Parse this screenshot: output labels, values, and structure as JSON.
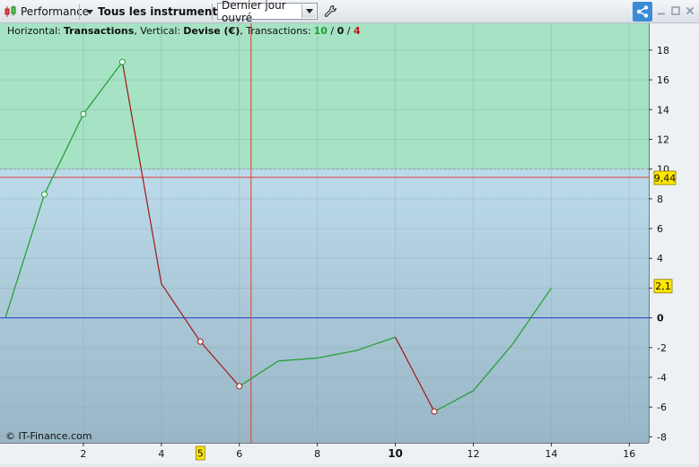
{
  "toolbar": {
    "performance_label": "Performance",
    "instruments_label": "Tous les instruments",
    "period_select": "Dernier jour ouvré"
  },
  "legend": {
    "horizontal_label": "Horizontal:",
    "horizontal_value": "Transactions",
    "vertical_label": ", Vertical:",
    "vertical_value": "Devise (€)",
    "transactions_label": ", Transactions:",
    "win_count": "10",
    "slash1": " / ",
    "neutral_count": "0",
    "slash2": " / ",
    "loss_count": "4"
  },
  "copyright": "© IT-Finance.com",
  "colors": {
    "gain_zone": "#a6e2c4",
    "loss_zone_top": "#bcdbea",
    "loss_zone_bottom": "#98b6c5",
    "up_line": "#1f9e2e",
    "down_line": "#a31616",
    "zero_line": "#1f3fd0",
    "ref_line": "#e03a3a",
    "cursor_line": "#e03a3a",
    "marker_fill": "#ffe600"
  },
  "chart_data": {
    "type": "line",
    "xlabel": "",
    "ylabel": "",
    "xlim": [
      0,
      16.5
    ],
    "ylim": [
      -8.4,
      19.8
    ],
    "x_ticks": [
      2,
      4,
      6,
      8,
      10,
      12,
      14,
      16
    ],
    "x_ticks_bold": [
      10
    ],
    "y_ticks": [
      18,
      16,
      14,
      12,
      10,
      8,
      6,
      4,
      2,
      0,
      -2,
      -4,
      -6,
      -8
    ],
    "y_ticks_bold": [
      0
    ],
    "grid": true,
    "gain_zone_threshold": 10,
    "reference_value": 9.44,
    "reference_label": "9,44",
    "last_value": 2.1,
    "last_value_label": "2,1",
    "cursor_x": 6.3,
    "cursor_x_label": "5",
    "cursor_x_label_at": 5,
    "points": [
      {
        "x": 0,
        "y": 0
      },
      {
        "x": 1,
        "y": 8.3
      },
      {
        "x": 2,
        "y": 13.7
      },
      {
        "x": 3,
        "y": 17.2
      },
      {
        "x": 4,
        "y": 2.3
      },
      {
        "x": 5,
        "y": -1.6
      },
      {
        "x": 6,
        "y": -4.6
      },
      {
        "x": 7,
        "y": -2.9
      },
      {
        "x": 8,
        "y": -2.7
      },
      {
        "x": 9,
        "y": -2.2
      },
      {
        "x": 10,
        "y": -1.3
      },
      {
        "x": 11,
        "y": -6.3
      },
      {
        "x": 12,
        "y": -4.9
      },
      {
        "x": 13,
        "y": -1.8
      },
      {
        "x": 14,
        "y": 2.0
      }
    ],
    "markers_at_x": [
      1,
      2,
      3,
      5,
      6,
      11
    ]
  }
}
